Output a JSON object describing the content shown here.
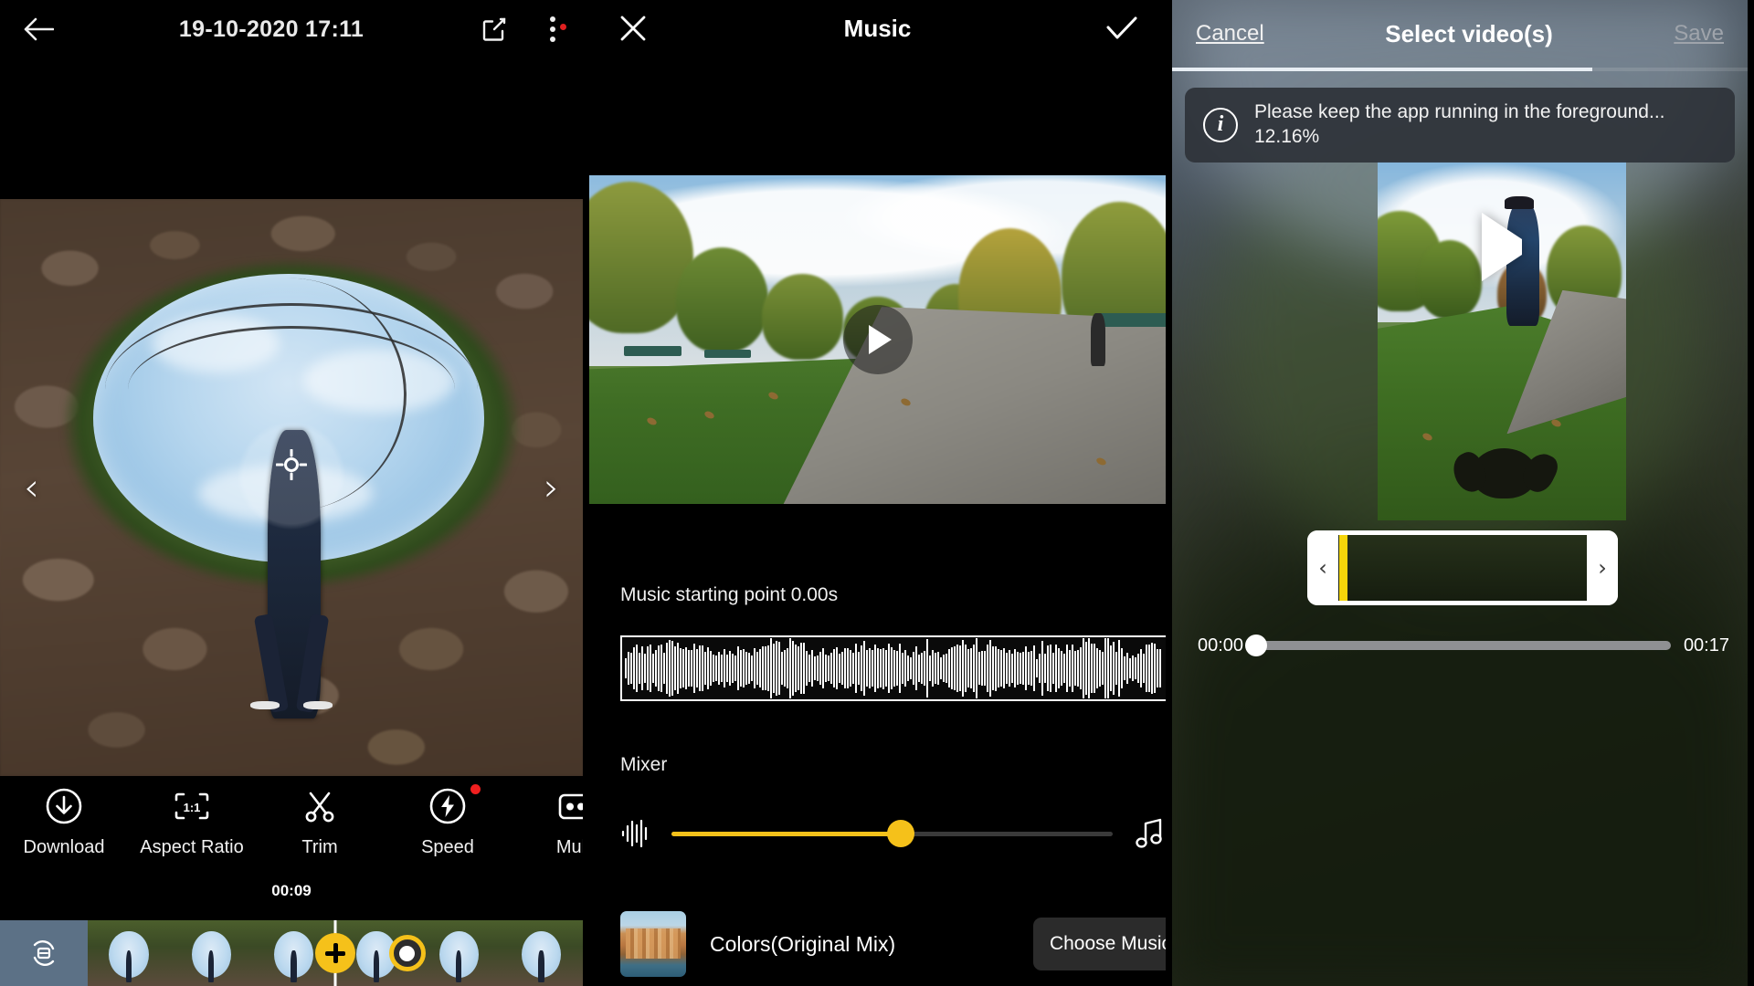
{
  "panel1": {
    "topbar": {
      "back_icon": "back-arrow-icon",
      "title": "19-10-2020 17:11",
      "share_icon": "share-icon",
      "more_icon": "more-vertical-icon"
    },
    "viewer": {
      "prev_label": "‹",
      "next_label": "›",
      "reticle_icon": "center-reticle-icon"
    },
    "toolbar": [
      {
        "label": "Download",
        "icon": "download-icon",
        "badge": false
      },
      {
        "label": "Aspect Ratio",
        "icon": "aspect-ratio-icon",
        "badge": false,
        "icon_text": "1:1"
      },
      {
        "label": "Trim",
        "icon": "scissors-icon",
        "badge": false
      },
      {
        "label": "Speed",
        "icon": "speed-icon",
        "badge": true
      },
      {
        "label": "Multi",
        "icon": "multiview-icon",
        "badge": false
      }
    ],
    "timecode": "00:09",
    "filmstrip": {
      "keyframe_button_icon": "keyframe-icon",
      "add_keyframe_icon": "plus-icon",
      "marker_icon": "keyframe-marker-icon",
      "frame_count": 6
    }
  },
  "panel2": {
    "topbar": {
      "close_icon": "close-icon",
      "title": "Music",
      "confirm_icon": "check-icon"
    },
    "preview": {
      "play_icon": "play-icon"
    },
    "music_start": {
      "label": "Music starting point 0.00s",
      "value": "0.00s"
    },
    "mixer": {
      "label": "Mixer",
      "left_icon": "waveform-icon",
      "right_icon": "music-note-icon",
      "value_percent": 52
    },
    "track": {
      "name": "Colors(Original Mix)",
      "artwork_icon": "album-art-icon",
      "choose_label": "Choose Music"
    }
  },
  "panel3": {
    "topbar": {
      "cancel_label": "Cancel",
      "title": "Select video(s)",
      "save_label": "Save"
    },
    "progress_percent": 12.16,
    "toast": {
      "icon": "info-icon",
      "message": "Please keep the app running in the foreground... 12.16%"
    },
    "preview": {
      "play_icon": "play-icon"
    },
    "trimmer": {
      "left_handle_icon": "chevron-left-icon",
      "right_handle_icon": "chevron-right-icon"
    },
    "seekbar": {
      "start_time": "00:00",
      "end_time": "00:17",
      "position_percent": 0
    }
  },
  "colors": {
    "accent_yellow": "#f5c11a",
    "trim_cursor_yellow": "#f5d50a",
    "badge_red": "#f01f1f",
    "strip_button_blue": "#5c7186",
    "toast_bg": "#2e3238",
    "save_disabled": "#9fa4ab"
  }
}
